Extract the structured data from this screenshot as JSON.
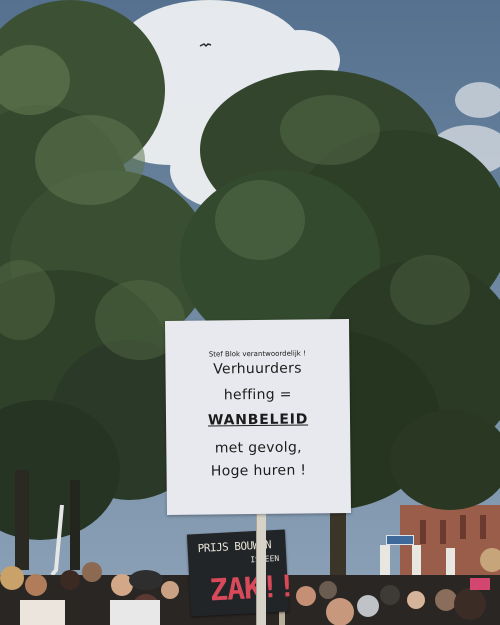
{
  "photo": {
    "subject": "protest-crowd-under-trees",
    "colors": {
      "sky": "#6d8aa6",
      "cloud": "#eef0f2",
      "foliage_dark": "#2b3a28",
      "foliage_light": "#5f7750",
      "sign_board": "#e8e9ee",
      "back_sign": "#222528",
      "back_sign_red": "#d8495a",
      "brick_building": "#9a5d4a"
    }
  },
  "main_sign": {
    "small_line": "Stef Blok verantwoordelijk !",
    "line1": "Verhuurders",
    "line2": "heffing =",
    "line3": "WANBELEID",
    "line4": "met gevolg,",
    "line5": "Hoge huren !"
  },
  "back_sign": {
    "line1": "PRIJS BOUWEN",
    "line2": "IS EEN",
    "line3": "ZAK!!"
  }
}
